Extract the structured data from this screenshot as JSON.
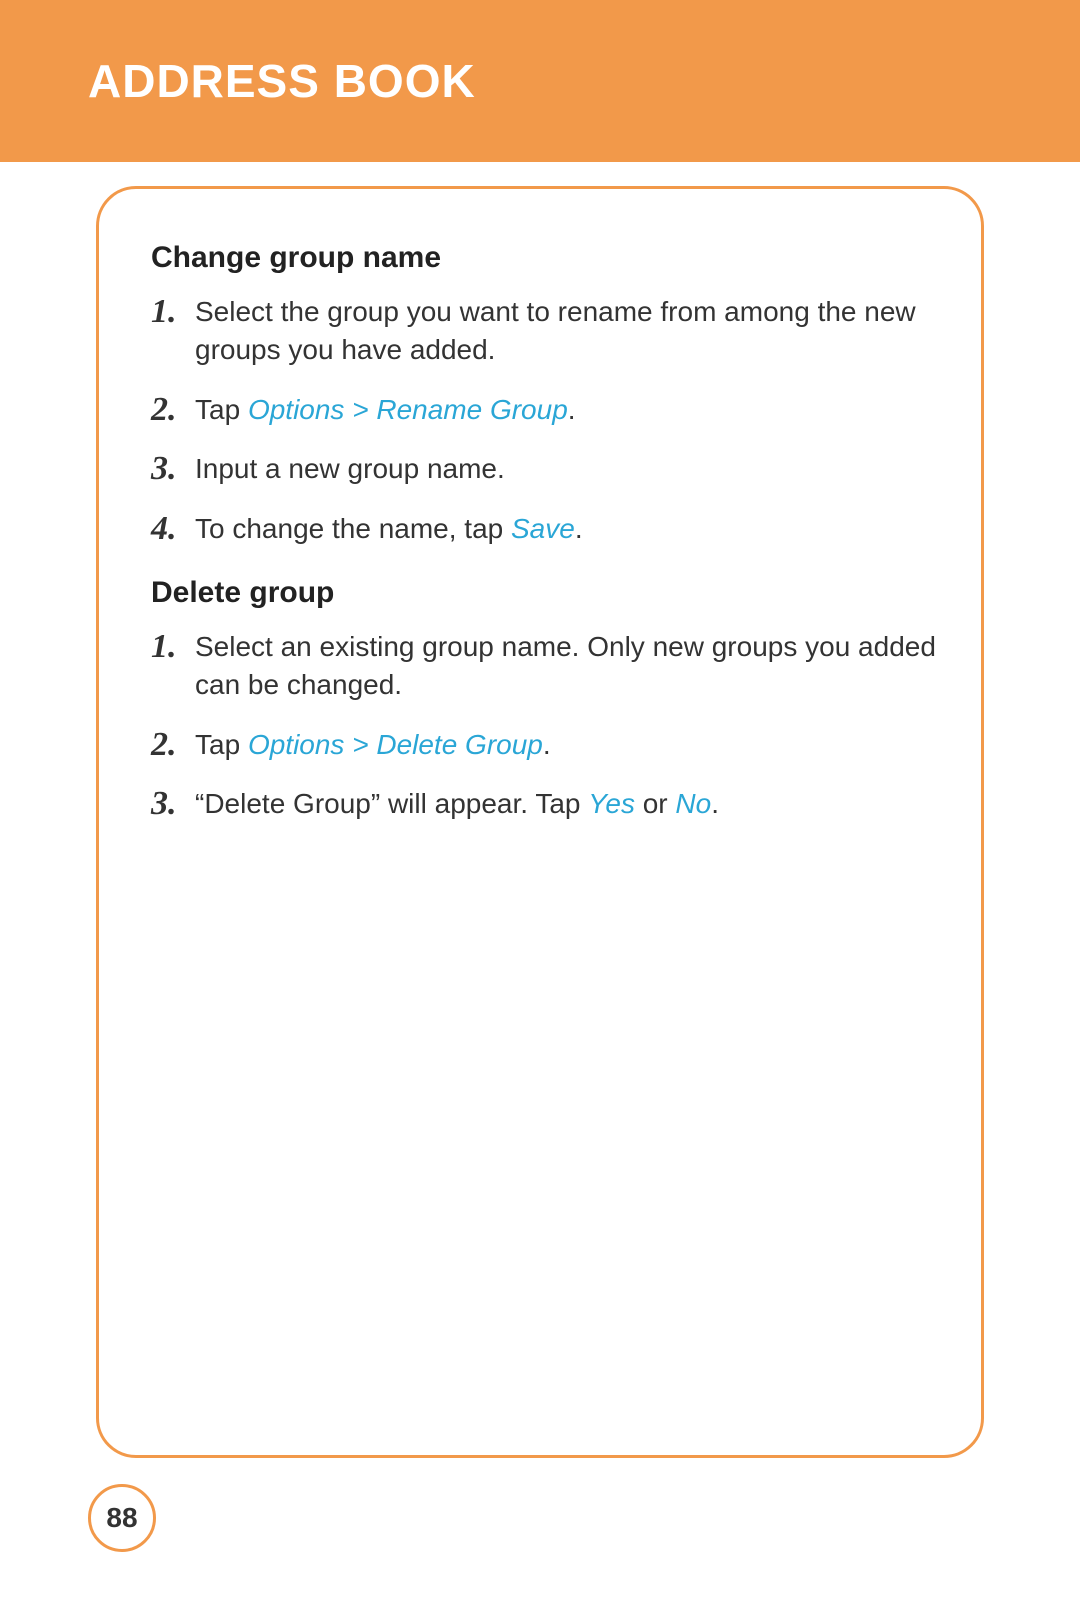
{
  "header": {
    "title": "ADDRESS BOOK"
  },
  "sections": {
    "change": {
      "title": "Change group name",
      "steps": {
        "s1_num": "1.",
        "s1": "Select the group you want to rename from among the new groups you have added.",
        "s2_num": "2.",
        "s2_pre": "Tap ",
        "s2_hl": "Options > Rename Group",
        "s2_post": ".",
        "s3_num": "3.",
        "s3": "Input a new group name.",
        "s4_num": "4.",
        "s4_pre": "To change the name, tap ",
        "s4_hl": "Save",
        "s4_post": "."
      }
    },
    "delete": {
      "title": "Delete group",
      "steps": {
        "s1_num": "1.",
        "s1": "Select an existing group name. Only new groups you added can be changed.",
        "s2_num": "2.",
        "s2_pre": "Tap ",
        "s2_hl": "Options > Delete Group",
        "s2_post": ".",
        "s3_num": "3.",
        "s3_pre": "“Delete Group” will appear. Tap ",
        "s3_hl1": "Yes",
        "s3_mid": " or ",
        "s3_hl2": "No",
        "s3_post": "."
      }
    }
  },
  "page_number": "88"
}
